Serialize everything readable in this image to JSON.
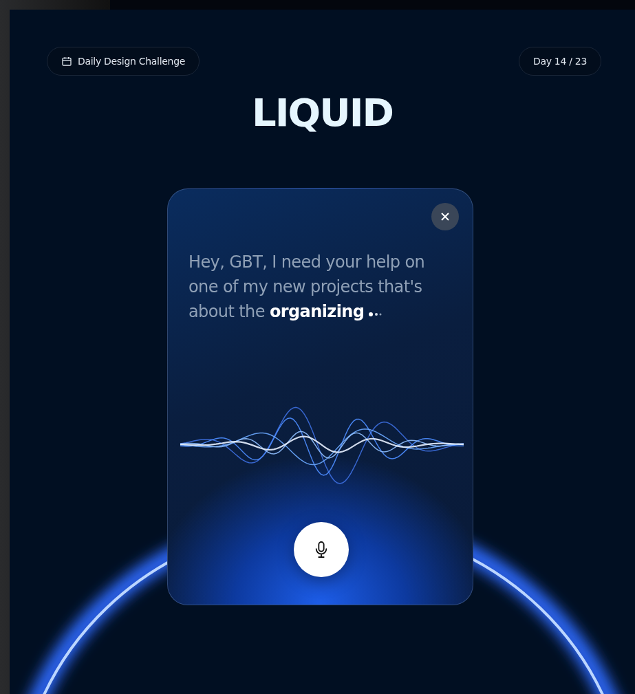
{
  "header": {
    "challenge_label": "Daily Design Challenge",
    "day_counter": "Day 14 / 23"
  },
  "logo": {
    "text": "LIQUID"
  },
  "assistant_card": {
    "transcript": "Hey, GBT, I need your help on one of my new projects that's about the **organizing**",
    "listening": true
  }
}
